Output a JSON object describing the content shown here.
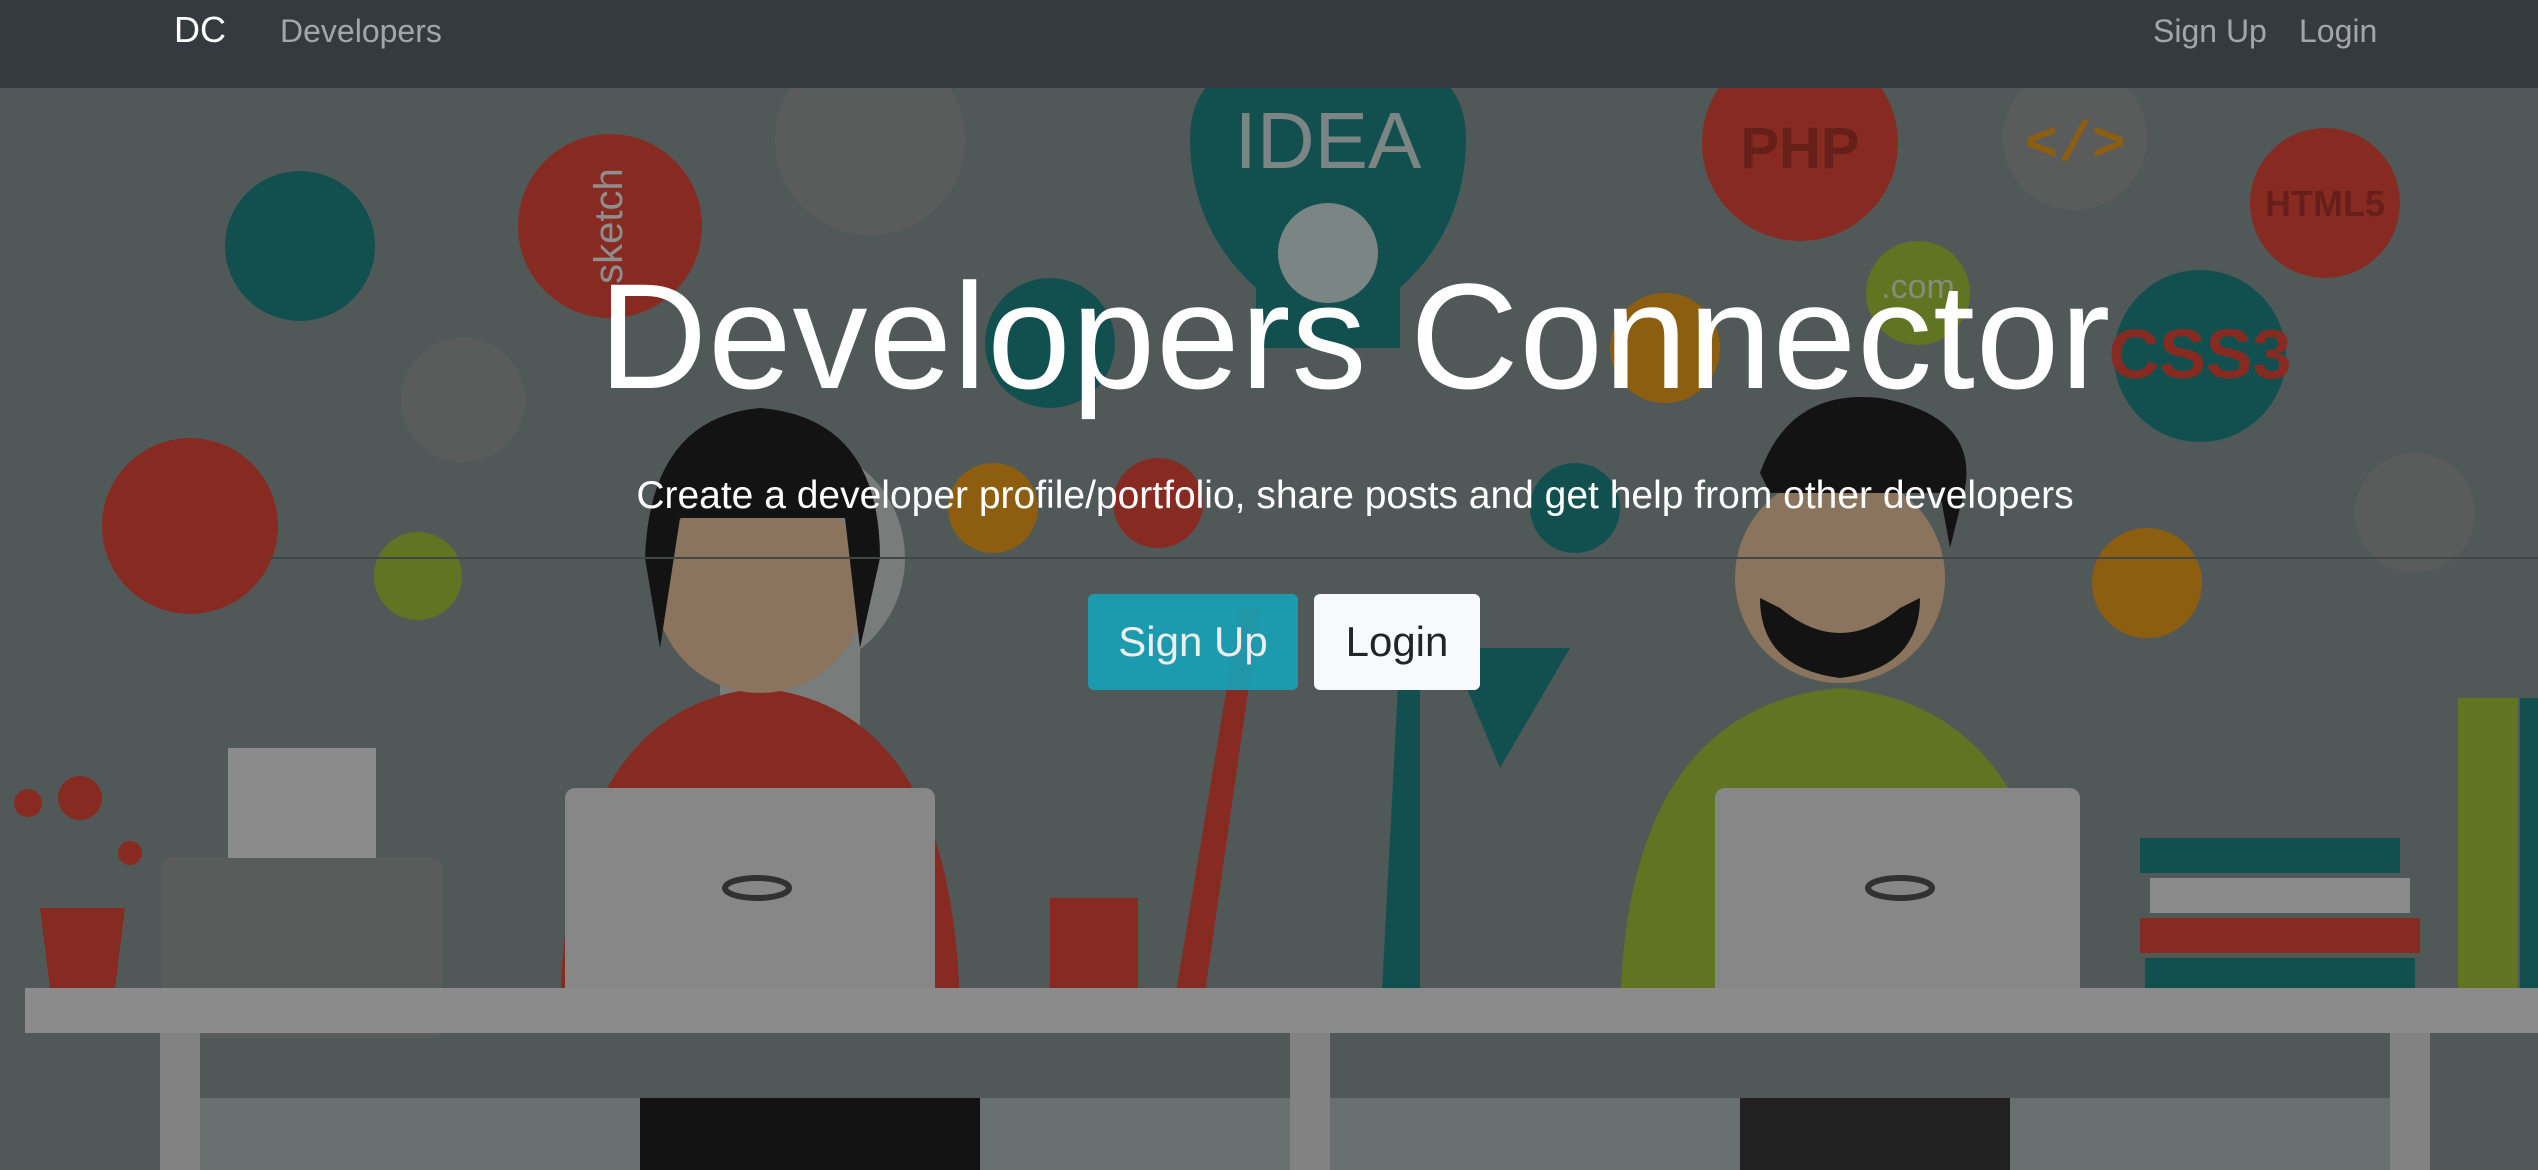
{
  "navbar": {
    "brand": "DC",
    "developers_link": "Developers",
    "signup_link": "Sign Up",
    "login_link": "Login"
  },
  "hero": {
    "title": "Developers Connector",
    "subtitle": "Create a developer profile/portfolio, share posts and get help from other developers",
    "signup_button": "Sign Up",
    "login_button": "Login",
    "background_icons": [
      "IDEA",
      "PHP",
      "</>",
      "CSS3",
      ".com",
      "sketch",
      "HTML5"
    ]
  },
  "colors": {
    "navbar": "#343a40",
    "signup": "#17a2b8",
    "login": "#f8f9fa"
  }
}
